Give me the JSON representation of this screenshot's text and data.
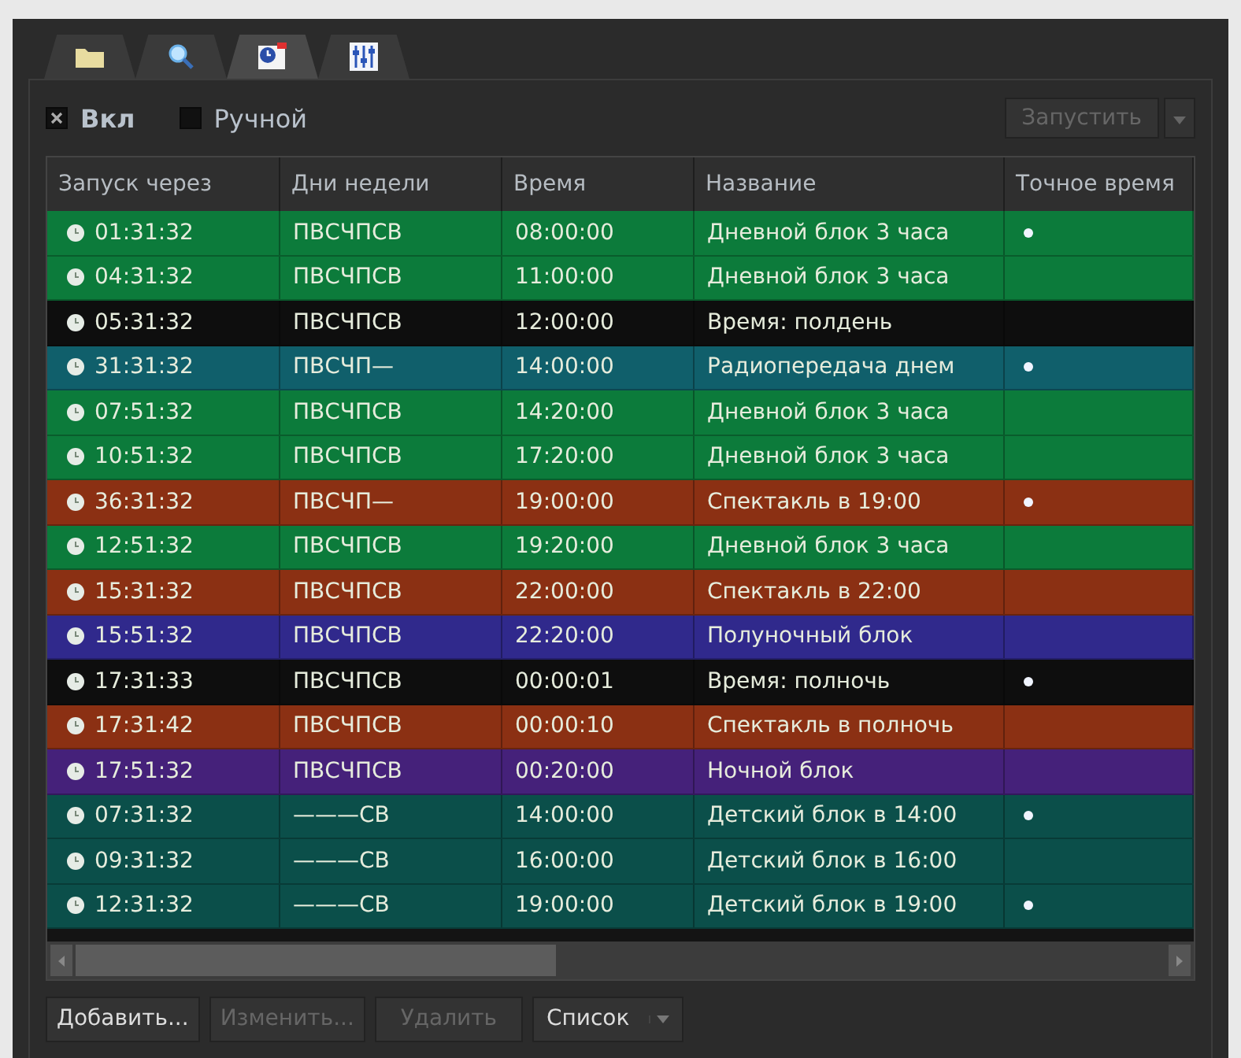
{
  "tabs": [
    {
      "kind": "folder",
      "selected": false
    },
    {
      "kind": "search",
      "selected": false
    },
    {
      "kind": "schedule",
      "selected": true
    },
    {
      "kind": "mixer",
      "selected": false
    }
  ],
  "options": [
    {
      "label": "Вкл",
      "checked": true
    },
    {
      "label": "Ручной",
      "checked": false
    }
  ],
  "run_button": {
    "label": "Запустить",
    "disabled": true
  },
  "table": {
    "columns": [
      "Запуск через",
      "Дни недели",
      "Время",
      "Название",
      "Точное время"
    ],
    "rows": [
      {
        "countdown": "01:31:32",
        "days": "ПВСЧПСВ",
        "time": "08:00:00",
        "name": "Дневной блок 3 часа",
        "exact": true,
        "color": "#0c7b3b"
      },
      {
        "countdown": "04:31:32",
        "days": "ПВСЧПСВ",
        "time": "11:00:00",
        "name": "Дневной блок 3 часа",
        "exact": false,
        "color": "#0c7b3b"
      },
      {
        "countdown": "05:31:32",
        "days": "ПВСЧПСВ",
        "time": "12:00:00",
        "name": "Время: полдень",
        "exact": false,
        "color": "#0e0e0e"
      },
      {
        "countdown": "31:31:32",
        "days": "ПВСЧП—",
        "time": "14:00:00",
        "name": "Радиопередача днем",
        "exact": true,
        "color": "#105f6b"
      },
      {
        "countdown": "07:51:32",
        "days": "ПВСЧПСВ",
        "time": "14:20:00",
        "name": "Дневной блок 3 часа",
        "exact": false,
        "color": "#0c7b3b"
      },
      {
        "countdown": "10:51:32",
        "days": "ПВСЧПСВ",
        "time": "17:20:00",
        "name": "Дневной блок 3 часа",
        "exact": false,
        "color": "#0c7b3b"
      },
      {
        "countdown": "36:31:32",
        "days": "ПВСЧП—",
        "time": "19:00:00",
        "name": "Спектакль в 19:00",
        "exact": true,
        "color": "#8b3013"
      },
      {
        "countdown": "12:51:32",
        "days": "ПВСЧПСВ",
        "time": "19:20:00",
        "name": "Дневной блок 3 часа",
        "exact": false,
        "color": "#0c7b3b"
      },
      {
        "countdown": "15:31:32",
        "days": "ПВСЧПСВ",
        "time": "22:00:00",
        "name": "Спектакль в 22:00",
        "exact": false,
        "color": "#8b3013"
      },
      {
        "countdown": "15:51:32",
        "days": "ПВСЧПСВ",
        "time": "22:20:00",
        "name": "Полуночный блок",
        "exact": false,
        "color": "#30298c"
      },
      {
        "countdown": "17:31:33",
        "days": "ПВСЧПСВ",
        "time": "00:00:01",
        "name": "Время: полночь",
        "exact": true,
        "color": "#0e0e0e"
      },
      {
        "countdown": "17:31:42",
        "days": "ПВСЧПСВ",
        "time": "00:00:10",
        "name": "Спектакль в полночь",
        "exact": false,
        "color": "#8b3013"
      },
      {
        "countdown": "17:51:32",
        "days": "ПВСЧПСВ",
        "time": "00:20:00",
        "name": "Ночной блок",
        "exact": false,
        "color": "#45217a"
      },
      {
        "countdown": "07:31:32",
        "days": "———СВ",
        "time": "14:00:00",
        "name": "Детский блок в 14:00",
        "exact": true,
        "color": "#0b4f4a"
      },
      {
        "countdown": "09:31:32",
        "days": "———СВ",
        "time": "16:00:00",
        "name": "Детский блок в 16:00",
        "exact": false,
        "color": "#0b4f4a"
      },
      {
        "countdown": "12:31:32",
        "days": "———СВ",
        "time": "19:00:00",
        "name": "Детский блок в 19:00",
        "exact": true,
        "color": "#0b4f4a"
      }
    ]
  },
  "buttons": [
    {
      "label": "Добавить...",
      "disabled": false,
      "kind": "plain"
    },
    {
      "label": "Изменить...",
      "disabled": true,
      "kind": "plain"
    },
    {
      "label": "Удалить",
      "disabled": true,
      "kind": "plain"
    },
    {
      "label": "Список",
      "disabled": false,
      "kind": "dropdown"
    }
  ]
}
